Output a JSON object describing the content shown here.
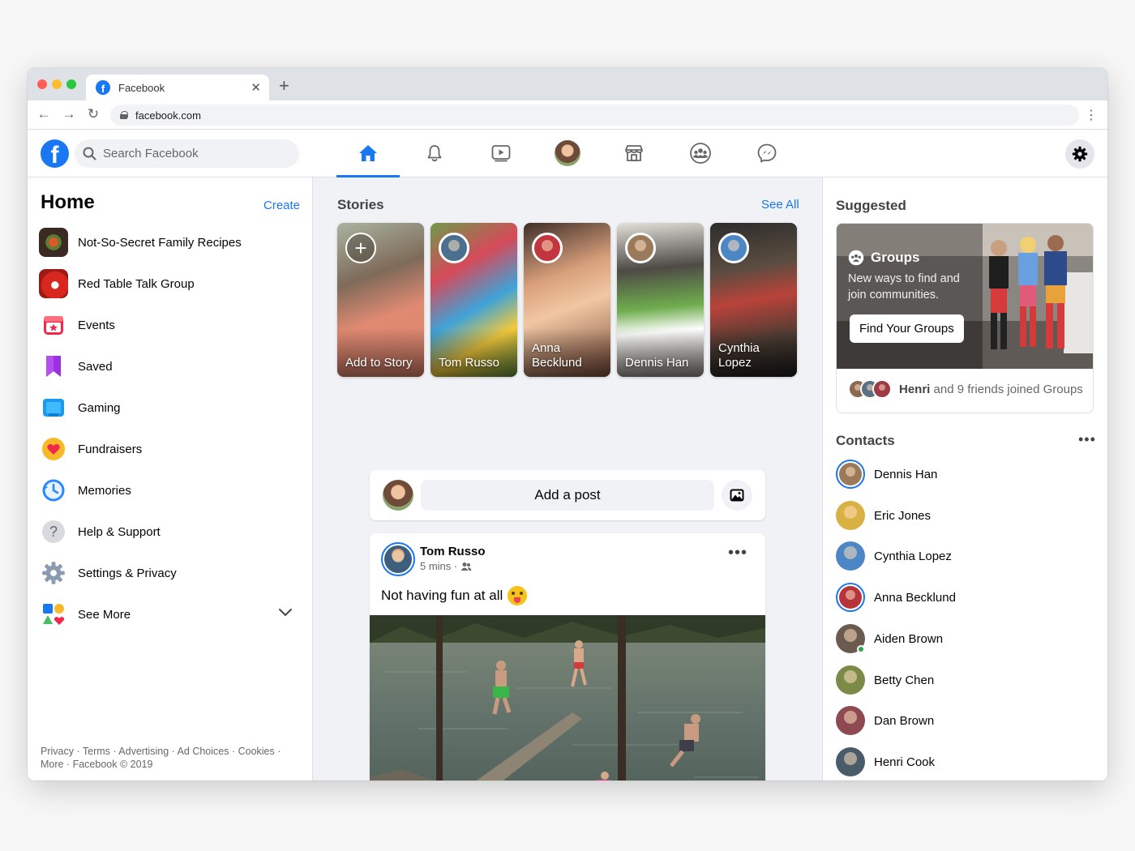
{
  "browser": {
    "tab_title": "Facebook",
    "url": "facebook.com"
  },
  "topbar": {
    "logo": "f",
    "search_placeholder": "Search Facebook",
    "nav_icons": [
      "home-icon",
      "bell-icon",
      "watch-icon",
      "profile-avatar",
      "marketplace-icon",
      "groups-icon",
      "messenger-icon"
    ],
    "accent_color": "#1877f2"
  },
  "left": {
    "title": "Home",
    "create": "Create",
    "items": [
      {
        "label": "Not-So-Secret Family Recipes",
        "icon": "group-thumbnail"
      },
      {
        "label": "Red Table Talk Group",
        "icon": "group-thumbnail"
      },
      {
        "label": "Events",
        "icon": "events-icon"
      },
      {
        "label": "Saved",
        "icon": "saved-icon"
      },
      {
        "label": "Gaming",
        "icon": "gaming-icon"
      },
      {
        "label": "Fundraisers",
        "icon": "fundraisers-icon"
      },
      {
        "label": "Memories",
        "icon": "memories-icon"
      },
      {
        "label": "Help & Support",
        "icon": "help-icon"
      },
      {
        "label": "Settings & Privacy",
        "icon": "gear-icon"
      },
      {
        "label": "See More",
        "icon": "shapes-icon"
      }
    ],
    "footer_line1": "Privacy · Terms · Advertising · Ad Choices · Cookies ·",
    "footer_line2": "More · Facebook © 2019"
  },
  "stories": {
    "title": "Stories",
    "see_all": "See All",
    "items": [
      {
        "name": "Add to Story"
      },
      {
        "name": "Tom Russo"
      },
      {
        "name": "Anna Becklund"
      },
      {
        "name": "Dennis Han"
      },
      {
        "name": "Cynthia Lopez"
      }
    ]
  },
  "composer": {
    "placeholder": "Add a post"
  },
  "post": {
    "author": "Tom Russo",
    "time": "5 mins ·",
    "text": "Not having fun at all"
  },
  "suggested": {
    "title": "Suggested",
    "groups_heading": "Groups",
    "groups_sub": "New ways to find and join communities.",
    "find_button": "Find Your Groups",
    "joined_name": "Henri",
    "joined_rest": "and 9 friends joined Groups"
  },
  "contacts": {
    "title": "Contacts",
    "items": [
      {
        "name": "Dennis Han",
        "ring": true,
        "online": false
      },
      {
        "name": "Eric Jones",
        "ring": false,
        "online": false
      },
      {
        "name": "Cynthia Lopez",
        "ring": false,
        "online": false
      },
      {
        "name": "Anna Becklund",
        "ring": true,
        "online": false
      },
      {
        "name": "Aiden Brown",
        "ring": false,
        "online": true
      },
      {
        "name": "Betty Chen",
        "ring": false,
        "online": false
      },
      {
        "name": "Dan Brown",
        "ring": false,
        "online": false
      },
      {
        "name": "Henri Cook",
        "ring": false,
        "online": false
      }
    ]
  }
}
